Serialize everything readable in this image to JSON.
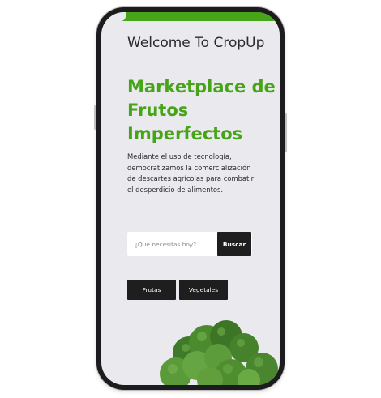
{
  "hero": {
    "welcome": "Welcome To CropUp",
    "headline": "Marketplace de Frutos Imperfectos",
    "description": "Mediante el uso de tecnología, democratizamos la comercialización de descartes agrícolas para combatir el desperdicio de alimentos."
  },
  "search": {
    "placeholder": "¿Qué necesitas hoy?",
    "button_label": "Buscar"
  },
  "categories": [
    {
      "label": "Frutas"
    },
    {
      "label": "Vegetales"
    }
  ],
  "colors": {
    "accent": "#46a417",
    "dark_button": "#1e1e1e",
    "screen_bg": "#eaeaee"
  },
  "image": {
    "icon": "broccoli-illustration"
  }
}
